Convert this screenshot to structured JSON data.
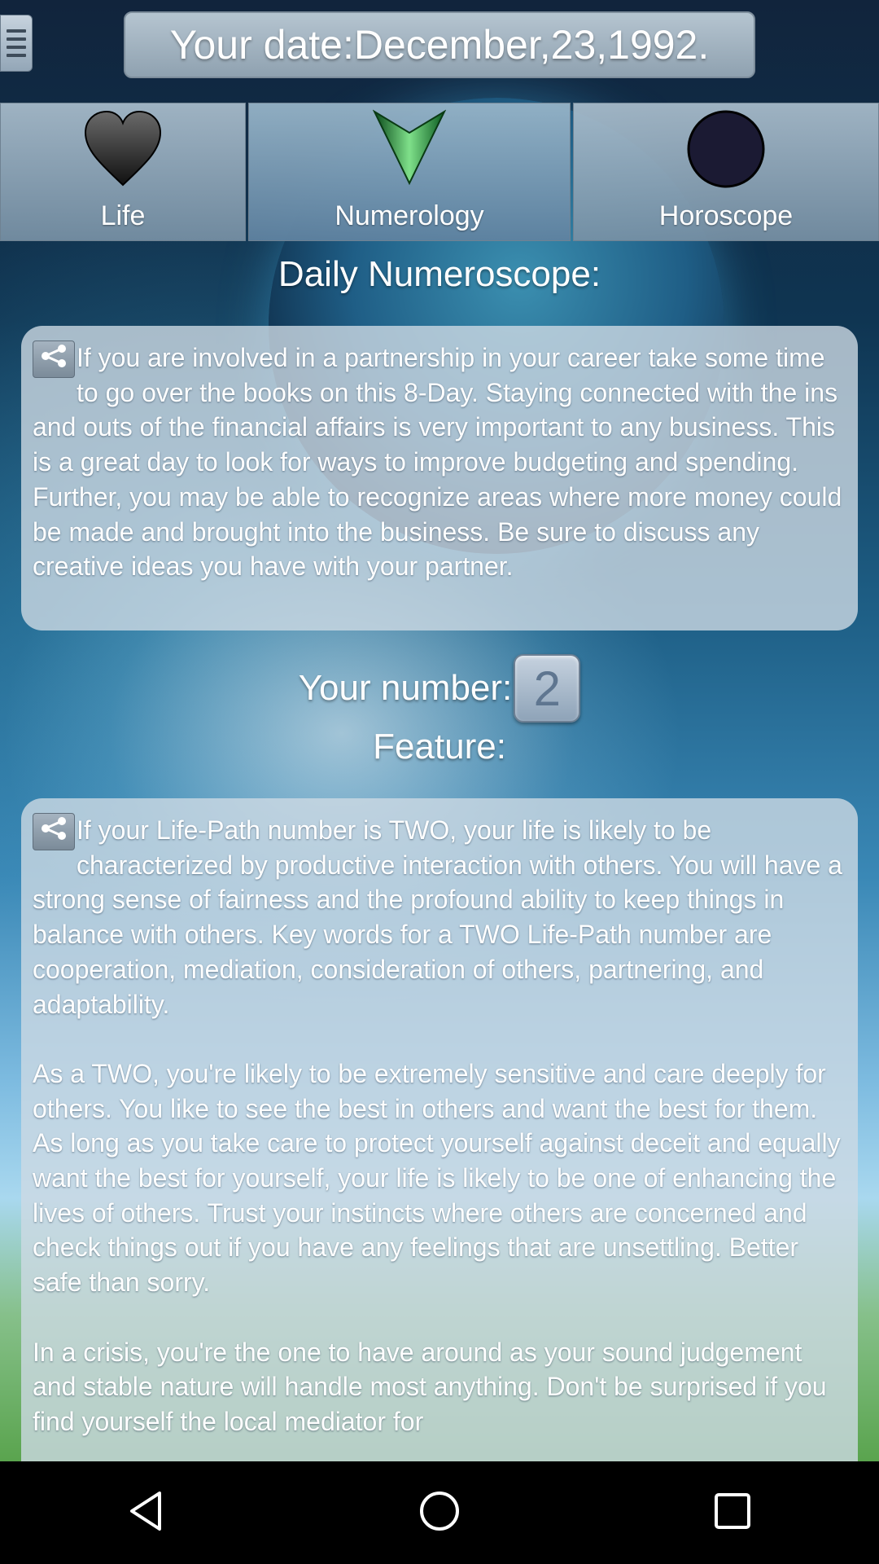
{
  "header": {
    "date_text": "Your date:December,23,1992."
  },
  "tabs": [
    {
      "label": "Life",
      "icon": "heart-icon"
    },
    {
      "label": "Numerology",
      "icon": "arrow-down-icon"
    },
    {
      "label": "Horoscope",
      "icon": "moon-icon"
    }
  ],
  "daily": {
    "title": "Daily Numeroscope:",
    "text": "If you are involved in a partnership in your career  take some time to go over the books on this 8-Day. Staying connected with the ins and outs of the financial affairs is very important to any business. This is a great day to look for ways to improve budgeting and spending. Further, you may be able to recognize areas where more money could be made and brought into the business. Be sure to discuss any creative ideas you have with your partner."
  },
  "number": {
    "label": "Your number:",
    "value": "2"
  },
  "feature": {
    "title": "Feature:",
    "text": "If your Life-Path number is TWO, your life is likely to be characterized by productive interaction with others. You will have a strong sense of fairness and the profound ability to keep things in balance with others. Key words for a TWO Life-Path number are cooperation, mediation, consideration of others, partnering, and adaptability.\n\nAs a TWO, you're likely to be extremely sensitive and care deeply for others. You like to see the best in others and want the best for them. As long as you take care to protect yourself against deceit and equally want the best for yourself, your life is likely to be one of enhancing the lives of others. Trust your instincts where others are concerned and check things out if you have any feelings that are unsettling. Better safe than sorry.\n\nIn a crisis, you're the one to have around as your sound judgement and stable nature will handle most anything. Don't be surprised if you find yourself the local mediator for"
  },
  "colors": {
    "panel": "#cddae4",
    "text": "#ffffff"
  }
}
